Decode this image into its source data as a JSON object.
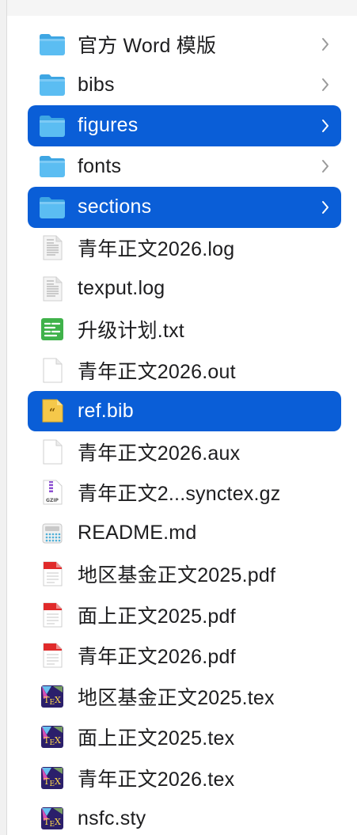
{
  "finder": {
    "items": [
      {
        "name": "官方 Word 模版",
        "kind": "folder",
        "icon": "folder-icon",
        "has_children": true,
        "selected": false
      },
      {
        "name": "bibs",
        "kind": "folder",
        "icon": "folder-icon",
        "has_children": true,
        "selected": false
      },
      {
        "name": "figures",
        "kind": "folder",
        "icon": "folder-icon",
        "has_children": true,
        "selected": true
      },
      {
        "name": "fonts",
        "kind": "folder",
        "icon": "folder-icon",
        "has_children": true,
        "selected": false
      },
      {
        "name": "sections",
        "kind": "folder",
        "icon": "folder-icon",
        "has_children": true,
        "selected": true
      },
      {
        "name": "青年正文2026.log",
        "kind": "log",
        "icon": "log-file-icon",
        "has_children": false,
        "selected": false
      },
      {
        "name": "texput.log",
        "kind": "log",
        "icon": "log-file-icon",
        "has_children": false,
        "selected": false
      },
      {
        "name": "升级计划.txt",
        "kind": "txt",
        "icon": "text-file-icon",
        "has_children": false,
        "selected": false
      },
      {
        "name": "青年正文2026.out",
        "kind": "blank",
        "icon": "blank-file-icon",
        "has_children": false,
        "selected": false
      },
      {
        "name": "ref.bib",
        "kind": "bib",
        "icon": "bib-file-icon",
        "has_children": false,
        "selected": true
      },
      {
        "name": "青年正文2026.aux",
        "kind": "blank",
        "icon": "blank-file-icon",
        "has_children": false,
        "selected": false
      },
      {
        "name": "青年正文2...synctex.gz",
        "kind": "gz",
        "icon": "gzip-archive-icon",
        "has_children": false,
        "selected": false
      },
      {
        "name": "README.md",
        "kind": "md",
        "icon": "markdown-file-icon",
        "has_children": false,
        "selected": false
      },
      {
        "name": "地区基金正文2025.pdf",
        "kind": "pdf",
        "icon": "pdf-file-icon",
        "has_children": false,
        "selected": false
      },
      {
        "name": "面上正文2025.pdf",
        "kind": "pdf",
        "icon": "pdf-file-icon",
        "has_children": false,
        "selected": false
      },
      {
        "name": "青年正文2026.pdf",
        "kind": "pdf",
        "icon": "pdf-file-icon",
        "has_children": false,
        "selected": false
      },
      {
        "name": "地区基金正文2025.tex",
        "kind": "tex",
        "icon": "tex-file-icon",
        "has_children": false,
        "selected": false
      },
      {
        "name": "面上正文2025.tex",
        "kind": "tex",
        "icon": "tex-file-icon",
        "has_children": false,
        "selected": false
      },
      {
        "name": "青年正文2026.tex",
        "kind": "tex",
        "icon": "tex-file-icon",
        "has_children": false,
        "selected": false
      },
      {
        "name": "nsfc.sty",
        "kind": "tex",
        "icon": "tex-file-icon",
        "has_children": false,
        "selected": false
      }
    ]
  },
  "colors": {
    "selection": "#0a5ed7",
    "folder": "#4ab4ee",
    "text": "#1d1d1f"
  }
}
